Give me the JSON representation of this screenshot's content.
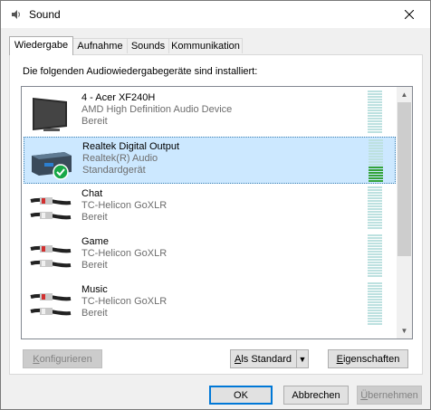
{
  "window": {
    "title": "Sound"
  },
  "tabs": [
    {
      "label": "Wiedergabe"
    },
    {
      "label": "Aufnahme"
    },
    {
      "label": "Sounds"
    },
    {
      "label": "Kommunikation"
    }
  ],
  "instruction": "Die folgenden Audiowiedergabegeräte sind installiert:",
  "devices": [
    {
      "name": "4 - Acer XF240H",
      "driver": "AMD High Definition Audio Device",
      "status": "Bereit",
      "icon": "monitor-icon"
    },
    {
      "name": "Realtek Digital Output",
      "driver": "Realtek(R) Audio",
      "status": "Standardgerät",
      "icon": "digital-output-icon",
      "selected": true,
      "level": 0.35
    },
    {
      "name": "Chat",
      "driver": "TC-Helicon GoXLR",
      "status": "Bereit",
      "icon": "rca-cable-icon"
    },
    {
      "name": "Game",
      "driver": "TC-Helicon GoXLR",
      "status": "Bereit",
      "icon": "rca-cable-icon"
    },
    {
      "name": "Music",
      "driver": "TC-Helicon GoXLR",
      "status": "Bereit",
      "icon": "rca-cable-icon"
    }
  ],
  "buttons": {
    "configure_prefix": "",
    "configure_ul": "K",
    "configure_rest": "onfigurieren",
    "set_default_ul": "A",
    "set_default_rest": "ls Standard",
    "properties_ul": "E",
    "properties_rest": "igenschaften",
    "ok": "OK",
    "cancel": "Abbrechen",
    "apply_ul": "Ü",
    "apply_rest": "bernehmen"
  },
  "colors": {
    "selection": "#cce8ff",
    "meter_idle": "#bde1e0",
    "meter_active": "#33a33a",
    "default_check": "#18a848"
  }
}
